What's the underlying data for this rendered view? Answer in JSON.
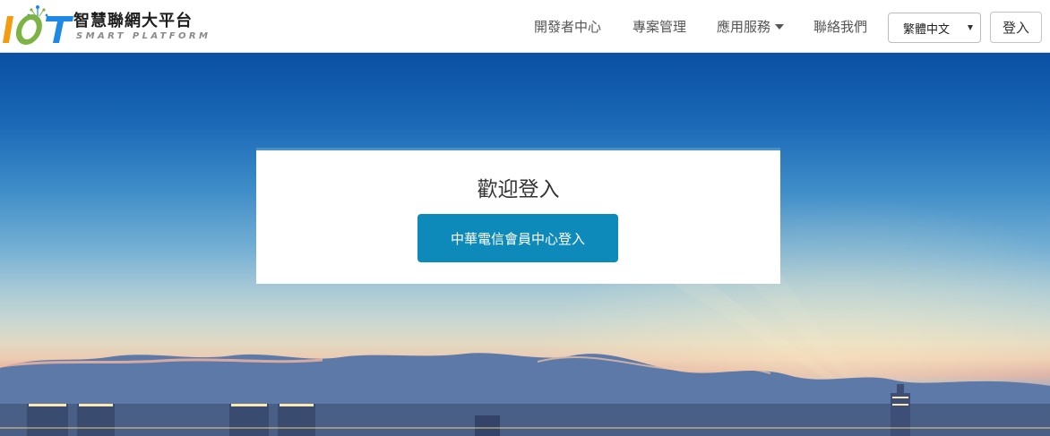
{
  "brand": {
    "logo_text": "IOT",
    "title": "智慧聯網大平台",
    "subtitle": "SMART PLATFORM"
  },
  "nav": {
    "items": [
      {
        "label": "開發者中心"
      },
      {
        "label": "專案管理"
      },
      {
        "label": "應用服務",
        "has_dropdown": true
      },
      {
        "label": "聯絡我們"
      }
    ],
    "language": {
      "selected": "繁體中文"
    },
    "login_label": "登入"
  },
  "login_card": {
    "title": "歡迎登入",
    "button_label": "中華電信會員中心登入"
  },
  "colors": {
    "accent_button": "#0d8ab9",
    "logo_orange": "#f39c12",
    "logo_green": "#7cb342",
    "logo_blue": "#1e88e5"
  },
  "icons": {
    "dropdown": "caret-down-icon",
    "select_arrow": "select-arrow-icon"
  }
}
